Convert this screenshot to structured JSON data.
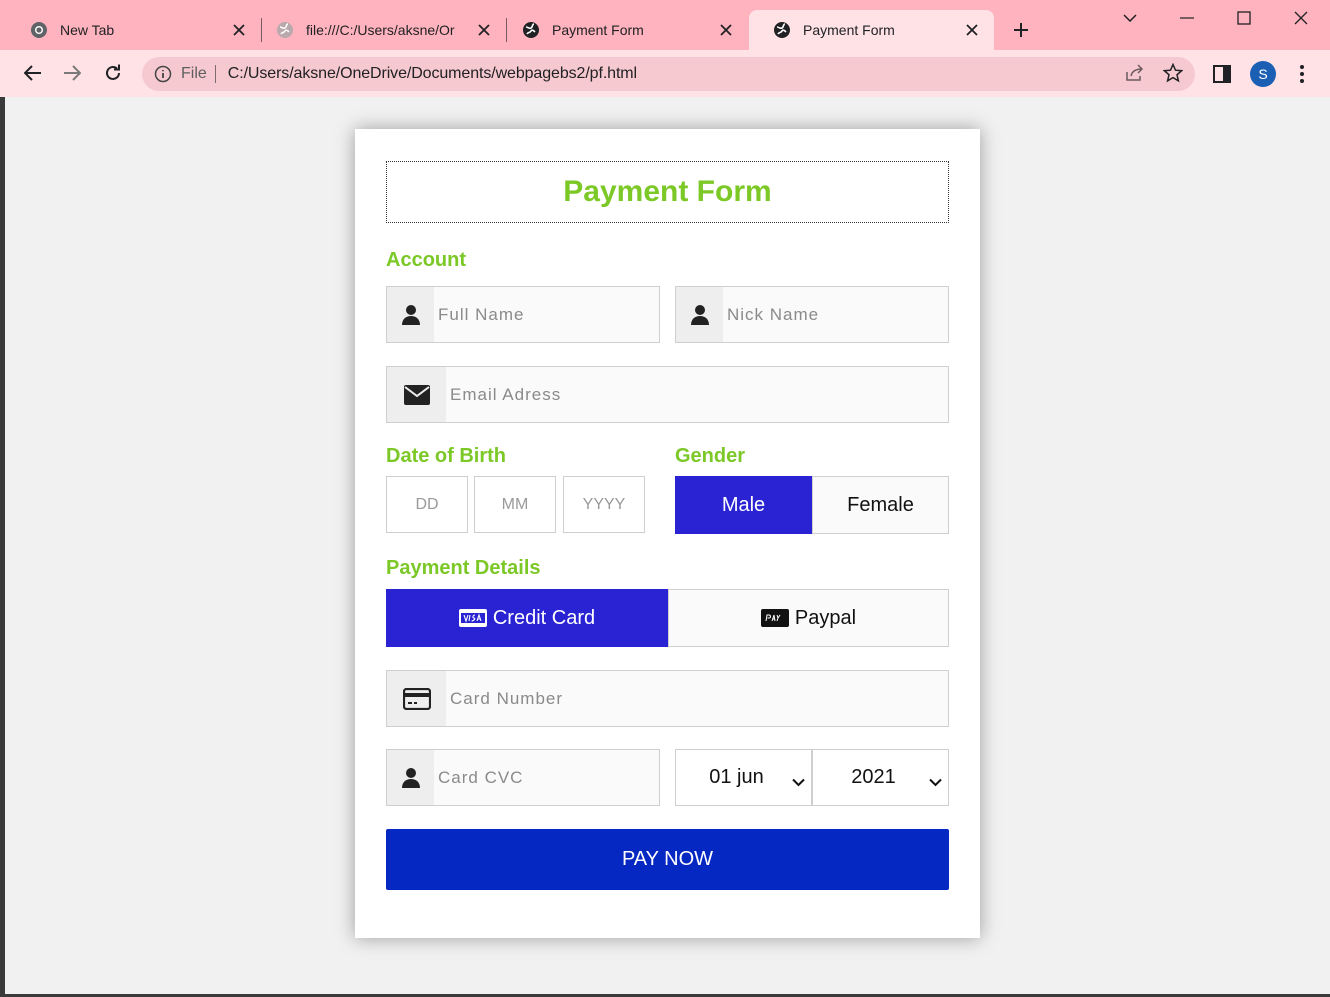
{
  "browser": {
    "tabs": [
      {
        "title": "New Tab",
        "favicon": "chrome-icon"
      },
      {
        "title": "file:///C:/Users/aksne/Or",
        "favicon": "globe-icon"
      },
      {
        "title": "Payment Form",
        "favicon": "globe-icon"
      },
      {
        "title": "Payment Form",
        "favicon": "globe-icon"
      }
    ],
    "active_tab_index": 3,
    "address": {
      "scheme": "File",
      "url": "C:/Users/aksne/OneDrive/Documents/webpagebs2/pf.html"
    },
    "profile_initial": "S",
    "colors": {
      "frame": "#ffb3be",
      "toolbar": "#ffe2e6",
      "omnibox": "#f5c9cf",
      "profile": "#1a5fb4"
    }
  },
  "form": {
    "title": "Payment Form",
    "colors": {
      "accent": "#7cc827",
      "selected": "#2a23d4",
      "pay_button": "#0628c2"
    },
    "account": {
      "heading": "Account",
      "full_name_placeholder": "Full Name",
      "nick_name_placeholder": "Nick Name",
      "email_placeholder": "Email Adress"
    },
    "dob": {
      "heading": "Date of Birth",
      "day_placeholder": "DD",
      "month_placeholder": "MM",
      "year_placeholder": "YYYY"
    },
    "gender": {
      "heading": "Gender",
      "options": [
        "Male",
        "Female"
      ],
      "selected": "Male"
    },
    "payment": {
      "heading": "Payment Details",
      "methods": [
        {
          "label": "Credit Card",
          "icon": "visa-card-icon"
        },
        {
          "label": "Paypal",
          "icon": "paypal-card-icon"
        }
      ],
      "selected": "Credit Card",
      "card_number_placeholder": "Card Number",
      "card_cvc_placeholder": "Card CVC",
      "expiry_month": "01 jun",
      "expiry_year": "2021"
    },
    "pay_button": "PAY NOW"
  }
}
